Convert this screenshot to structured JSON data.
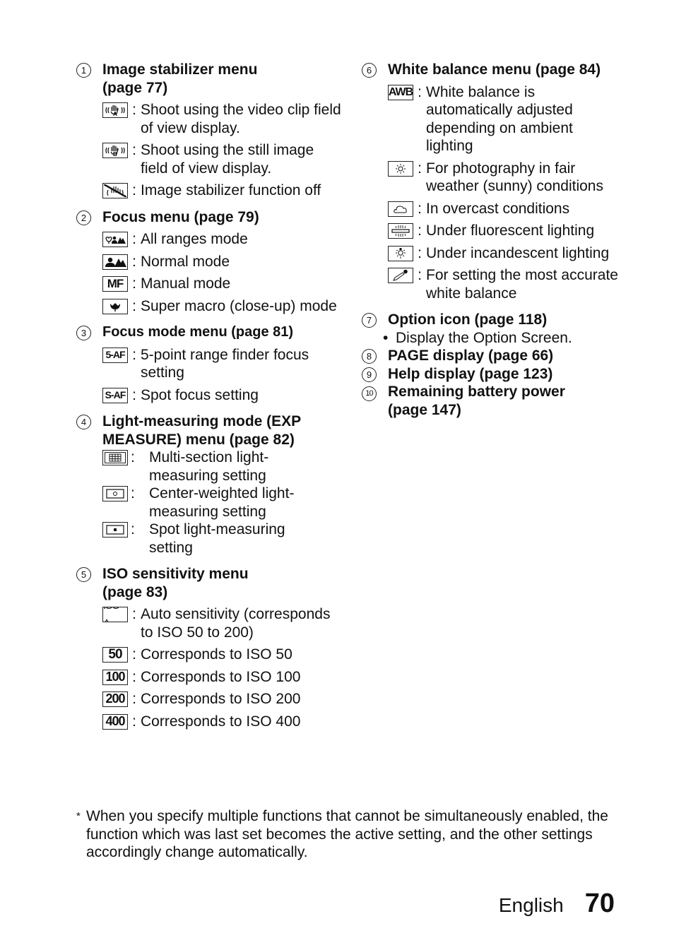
{
  "sections_left": [
    {
      "num": "1",
      "title": "Image stabilizer menu (page 77)",
      "items": [
        {
          "icon": "stabilizer-a-icon",
          "desc": "Shoot using the video clip field of view display."
        },
        {
          "icon": "stabilizer-b-icon",
          "desc": "Shoot using the still image field of view display."
        },
        {
          "icon": "stabilizer-off-icon",
          "desc": "Image stabilizer function off"
        }
      ]
    },
    {
      "num": "2",
      "title": "Focus menu (page 79)",
      "items": [
        {
          "icon": "all-ranges-icon",
          "desc": "All ranges mode"
        },
        {
          "icon": "normal-mode-icon",
          "desc": "Normal mode"
        },
        {
          "icon": "manual-focus-icon",
          "icon_text": "MF",
          "desc": "Manual mode"
        },
        {
          "icon": "super-macro-icon",
          "desc": "Super macro (close-up) mode"
        }
      ]
    },
    {
      "num": "3",
      "title": "Focus mode menu (page 81)",
      "items": [
        {
          "icon": "five-point-af-icon",
          "icon_text": "5-AF",
          "desc": "5-point range finder focus setting"
        },
        {
          "icon": "spot-af-icon",
          "icon_text": "S-AF",
          "desc": "Spot focus setting"
        }
      ]
    },
    {
      "num": "4",
      "title": "Light-measuring mode (EXP MEASURE) menu (page 82)",
      "items": [
        {
          "icon": "multi-section-metering-icon",
          "desc": "Multi-section light-measuring setting"
        },
        {
          "icon": "center-weighted-metering-icon",
          "desc": "Center-weighted light-measuring setting"
        },
        {
          "icon": "spot-metering-icon",
          "desc": "Spot light-measuring setting"
        }
      ]
    },
    {
      "num": "5",
      "title": "ISO sensitivity menu (page 83)",
      "items": [
        {
          "icon": "iso-auto-icon",
          "icon_text": "ISO-A",
          "desc": "Auto sensitivity (corresponds to ISO 50 to 200)"
        },
        {
          "icon": "iso-50-icon",
          "icon_text": "50",
          "desc": "Corresponds to ISO 50"
        },
        {
          "icon": "iso-100-icon",
          "icon_text": "100",
          "desc": "Corresponds to ISO 100"
        },
        {
          "icon": "iso-200-icon",
          "icon_text": "200",
          "desc": "Corresponds to ISO 200"
        },
        {
          "icon": "iso-400-icon",
          "icon_text": "400",
          "desc": "Corresponds to ISO 400"
        }
      ]
    }
  ],
  "sections_right": [
    {
      "num": "6",
      "title": "White balance menu (page 84)",
      "items": [
        {
          "icon": "awb-icon",
          "icon_text": "AWB",
          "desc": "White balance is automatically adjusted depending on ambient lighting"
        },
        {
          "icon": "sunny-icon",
          "desc": "For photography in fair weather (sunny) conditions"
        },
        {
          "icon": "cloudy-icon",
          "desc": "In overcast conditions"
        },
        {
          "icon": "fluorescent-icon",
          "desc": "Under fluorescent lighting"
        },
        {
          "icon": "incandescent-icon",
          "desc": "Under incandescent lighting"
        },
        {
          "icon": "eyedropper-icon",
          "desc": "For setting the most accurate white balance"
        }
      ]
    },
    {
      "num": "7",
      "title": "Option icon (page 118)",
      "bullet": "Display the Option Screen."
    },
    {
      "num": "8",
      "title": "PAGE display (page 66)"
    },
    {
      "num": "9",
      "title": "Help display (page 123)"
    },
    {
      "num": "10",
      "title": "Remaining battery power (page 147)"
    }
  ],
  "footnote": {
    "marker": "*",
    "text": "When you specify multiple functions that cannot be simultaneously enabled, the function which was last set becomes the active setting, and the other settings accordingly change automatically."
  },
  "footer": {
    "language": "English",
    "page_number": "70"
  },
  "colon": ":",
  "bullet_glyph": "•"
}
